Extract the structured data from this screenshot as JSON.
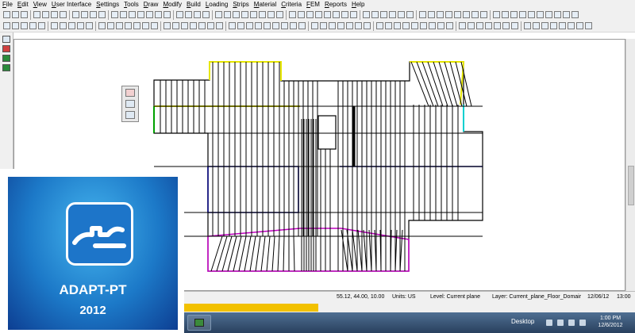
{
  "menu": [
    "File",
    "Edit",
    "View",
    "User Interface",
    "Settings",
    "Tools",
    "Draw",
    "Modify",
    "Build",
    "Loading",
    "Strips",
    "Material",
    "Criteria",
    "FEM",
    "Reports",
    "Help"
  ],
  "status": {
    "coords": "55.12, 44.00, 10.00",
    "units": "Units: US",
    "level": "Level: Current plane",
    "layer": "Layer: Current_plane_Floor_Domair",
    "date": "12/06/12",
    "time": "13:00"
  },
  "progress_fraction": 0.3,
  "taskbar": {
    "desktop": "Desktop",
    "clock_time": "1:00 PM",
    "clock_date": "12/6/2012"
  },
  "logo": {
    "name": "ADAPT-PT",
    "year": "2012"
  },
  "colors": {
    "accent_blue": "#1d75c9",
    "progress_yellow": "#f2c100",
    "outline_yellow": "#e6e600",
    "outline_magenta": "#c000c0",
    "outline_navy": "#00007a",
    "outline_cyan": "#00d0d0",
    "outline_green": "#00a000"
  },
  "icons": [
    "new-file-icon",
    "open-icon",
    "save-icon",
    "print-icon",
    "undo-icon",
    "redo-icon",
    "zoom-icon",
    "pan-icon",
    "grid-icon",
    "line-icon",
    "circle-icon",
    "slab-icon",
    "beam-icon",
    "column-icon",
    "tendon-icon",
    "strip-icon"
  ]
}
